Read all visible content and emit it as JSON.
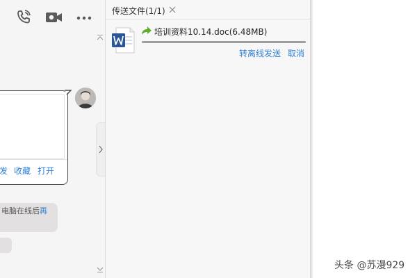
{
  "chat": {
    "header_icons": [
      "phone-icon",
      "video-call-icon",
      "more-icon"
    ],
    "bubble_actions": [
      "发",
      "收藏",
      "打开"
    ],
    "gray_message": {
      "text": "电脑在线后",
      "link": "再"
    }
  },
  "transfer": {
    "tab_title": "传送文件(1/1)",
    "file": {
      "icon": "word-document-icon",
      "name": "培训资料10.14.doc(6.48MB)",
      "progress": 1.0
    },
    "actions": {
      "offline_send": "转离线发送",
      "cancel": "取消"
    }
  },
  "watermark": "头条 @苏漫929",
  "colors": {
    "link": "#2f7fd6",
    "word_blue": "#2b5797",
    "arrow_green": "#5fae2e"
  }
}
